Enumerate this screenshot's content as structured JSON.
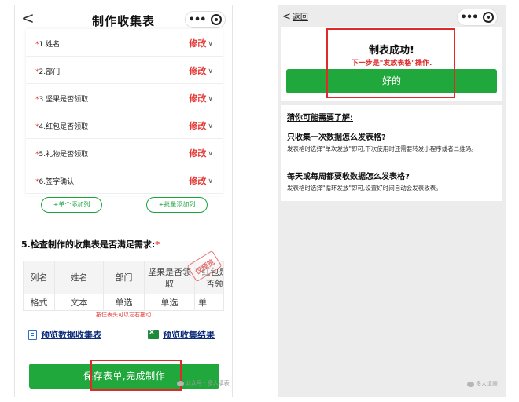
{
  "left": {
    "nav": {
      "back": "<",
      "title": "制作收集表",
      "more": "•••"
    },
    "fields": [
      {
        "index": "*",
        "label": "1.姓名",
        "edit": "修改"
      },
      {
        "index": "*",
        "label": "2.部门",
        "edit": "修改"
      },
      {
        "index": "*",
        "label": "3.坚果是否领取",
        "edit": "修改"
      },
      {
        "index": "*",
        "label": "4.红包是否领取",
        "edit": "修改"
      },
      {
        "index": "*",
        "label": "5.礼物是否领取",
        "edit": "修改"
      },
      {
        "index": "*",
        "label": "6.签字确认",
        "edit": "修改"
      }
    ],
    "add_single": "+单个添加列",
    "add_batch": "+批量添加列",
    "check_title": "5.检查制作的收集表是否满足需求:",
    "check_req": "*",
    "table": {
      "headers": [
        "列名",
        "姓名",
        "部门",
        "坚果是否领取",
        "红包是否领"
      ],
      "types": [
        "格式",
        "文本",
        "单选",
        "单选",
        "单"
      ]
    },
    "stamp": "仅预览",
    "drag_hint": "按住表头可以左右拖动",
    "preview_data": "预览数据收集表",
    "preview_result": "预览收集结果",
    "save": "保存表单,完成制作",
    "watermark": "公众号 · 多人填表"
  },
  "right": {
    "nav": {
      "back": "返回",
      "more": "•••"
    },
    "success_title": "制表成功!",
    "success_sub": "下一步是\"发放表格\"操作.",
    "ok": "好的",
    "faq_intro": "猜你可能需要了解:",
    "q1": "只收集一次数据怎么发表格?",
    "a1": "发表格时选择\"单次发放\"即可,下次使用时还需要转发小程序或者二维码。",
    "q2": "每天或每周都要收数据怎么发表格?",
    "a2": "发表格时选择\"循环发放\"即可,设置好时间自动会发表收表。",
    "watermark": "多人填表"
  },
  "colors": {
    "accent_green": "#21a83c",
    "edit_red": "#e53935",
    "highlight_red": "#e02a2a",
    "link_navy": "#0b2a7a"
  }
}
